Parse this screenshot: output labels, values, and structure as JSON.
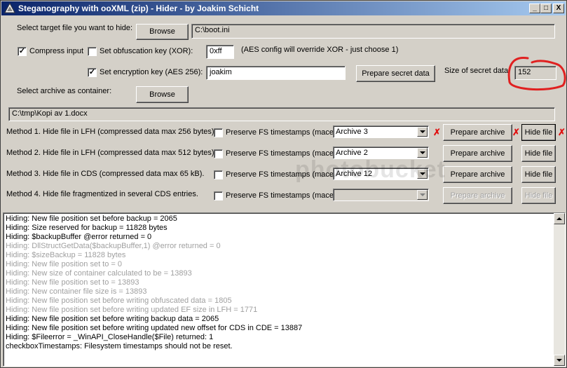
{
  "window": {
    "title": "Steganography with ooXML (zip) - Hider - by Joakim Schicht",
    "minimize_label": "_",
    "maximize_label": "□",
    "close_label": "X"
  },
  "target": {
    "label": "Select target file you want to hide:",
    "browse_label": "Browse",
    "path": "C:\\boot.ini"
  },
  "options": {
    "compress_label": "Compress input",
    "compress_checked": "✓",
    "obfuscation_label": "Set obfuscation key (XOR):",
    "obfuscation_value": "0xff",
    "xor_note": "(AES config will override XOR - just choose 1)",
    "encryption_label": "Set encryption key (AES 256):",
    "encryption_checked": "✓",
    "encryption_value": "joakim",
    "prepare_secret_label": "Prepare secret data",
    "size_label": "Size of secret data:",
    "size_value": "152"
  },
  "archive": {
    "label": "Select archive as container:",
    "browse_label": "Browse",
    "path": "C:\\tmp\\Kopi av 1.docx"
  },
  "methods": [
    {
      "label": "Method 1. Hide file in LFH (compressed data max 256 bytes).",
      "preserve_label": "Preserve FS timestamps (mace)",
      "combo_value": "Archive  3",
      "prepare_label": "Prepare archive",
      "hide_label": "Hide file"
    },
    {
      "label": "Method 2. Hide file in LFH (compressed data max 512 bytes).",
      "preserve_label": "Preserve FS timestamps (mace)",
      "combo_value": "Archive  2",
      "prepare_label": "Prepare archive",
      "hide_label": "Hide file"
    },
    {
      "label": "Method 3. Hide file in CDS (compressed data max 65 kB).",
      "preserve_label": "Preserve FS timestamps (mace)",
      "combo_value": "Archive  12",
      "prepare_label": "Prepare archive",
      "hide_label": "Hide file"
    },
    {
      "label": "Method 4. Hide file fragmentized in several CDS entries.",
      "preserve_label": "Preserve FS timestamps (mace)",
      "combo_value": "",
      "prepare_label": "Prepare archive",
      "hide_label": "Hide file"
    }
  ],
  "annotations": {
    "mark": "✗",
    "highlight_color": "#e02020"
  },
  "watermark": "photobucket",
  "log": [
    {
      "text": "Hiding: New file position set before backup = 2065",
      "style": "normal"
    },
    {
      "text": "Hiding: Size reserved for backup = 11828 bytes",
      "style": "normal"
    },
    {
      "text": "Hiding: $backupBuffer @error returned = 0",
      "style": "normal"
    },
    {
      "text": "Hiding: DllStructGetData($backupBuffer,1) @error returned = 0",
      "style": "grey"
    },
    {
      "text": "Hiding: $sizeBackup = 11828 bytes",
      "style": "grey"
    },
    {
      "text": "Hiding: New file position set to = 0",
      "style": "grey"
    },
    {
      "text": "Hiding: New size of container calculated to be = 13893",
      "style": "grey"
    },
    {
      "text": "Hiding: New file position set to = 13893",
      "style": "grey"
    },
    {
      "text": "Hiding: New container file size is = 13893",
      "style": "grey"
    },
    {
      "text": "Hiding: New file position set before writing obfuscated data = 1805",
      "style": "grey"
    },
    {
      "text": "Hiding: New file position set before writing updated EF size in LFH = 1771",
      "style": "grey"
    },
    {
      "text": "Hiding: New file position set before writing backup data = 2065",
      "style": "normal"
    },
    {
      "text": "Hiding: New file position set before writing updated new offset for CDS in CDE = 13887",
      "style": "normal"
    },
    {
      "text": "Hiding: $Fileerror = _WinAPI_CloseHandle($File) returned: 1",
      "style": "normal"
    },
    {
      "text": "checkboxTimestamps: Filesystem timestamps should not be reset.",
      "style": "normal"
    }
  ]
}
